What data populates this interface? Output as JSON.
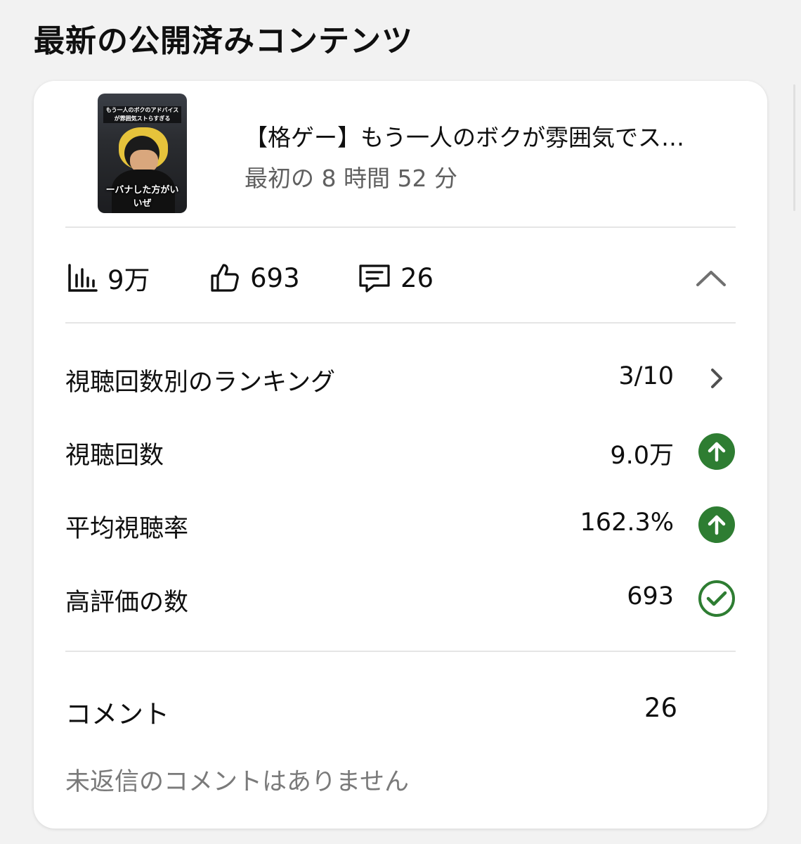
{
  "header": {
    "title": "最新の公開済みコンテンツ"
  },
  "video": {
    "thumbnail_caption_top": "もう一人のボクのアドバイスが雰囲気ストらすぎる",
    "thumbnail_caption_bottom": "ーバナした方がいいぜ",
    "title": "【格ゲー】もう一人のボクが雰囲気でス…",
    "subtitle": "最初の 8 時間 52 分"
  },
  "stats": {
    "views": {
      "icon": "bar-chart-icon",
      "value": "9万"
    },
    "likes": {
      "icon": "thumbs-up-icon",
      "value": "693"
    },
    "comments": {
      "icon": "comment-icon",
      "value": "26"
    },
    "collapse_icon": "chevron-up-icon"
  },
  "metrics": {
    "ranking": {
      "label": "視聴回数別のランキング",
      "value": "3/10",
      "icon": "chevron-right-icon"
    },
    "views": {
      "label": "視聴回数",
      "value": "9.0万",
      "icon": "arrow-up-circle-icon"
    },
    "avg_view_rate": {
      "label": "平均視聴率",
      "value": "162.3%",
      "icon": "arrow-up-circle-icon"
    },
    "likes": {
      "label": "高評価の数",
      "value": "693",
      "icon": "check-circle-icon"
    }
  },
  "comments_section": {
    "label": "コメント",
    "value": "26",
    "note": "未返信のコメントはありません"
  },
  "colors": {
    "positive": "#2e7d32",
    "text": "#0f0f0f",
    "secondary": "#606060",
    "divider": "#e5e5e5"
  }
}
